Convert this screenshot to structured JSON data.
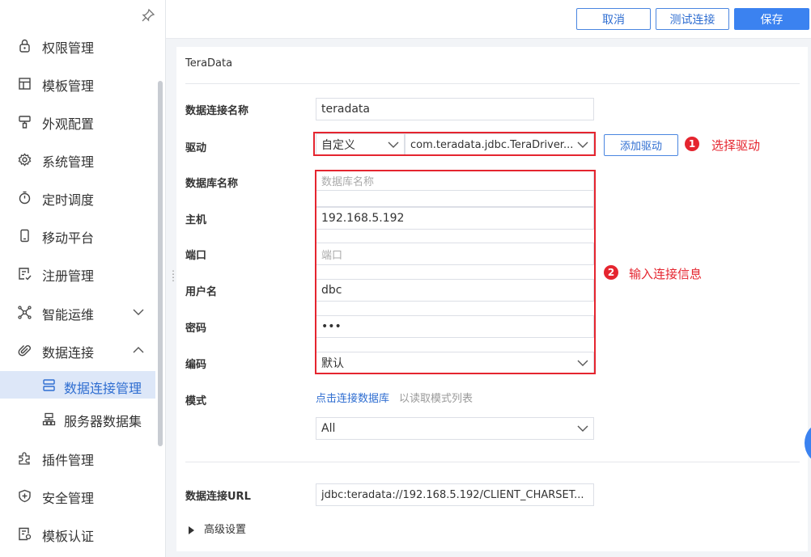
{
  "sidebar": {
    "items": [
      {
        "label": "权限管理",
        "icon": "lock-icon"
      },
      {
        "label": "模板管理",
        "icon": "template-icon"
      },
      {
        "label": "外观配置",
        "icon": "brush-icon"
      },
      {
        "label": "系统管理",
        "icon": "gear-icon"
      },
      {
        "label": "定时调度",
        "icon": "timer-icon"
      },
      {
        "label": "移动平台",
        "icon": "mobile-icon"
      },
      {
        "label": "注册管理",
        "icon": "register-icon"
      },
      {
        "label": "智能运维",
        "icon": "nodes-icon",
        "expandable": true,
        "expanded": false
      },
      {
        "label": "数据连接",
        "icon": "paperclip-icon",
        "expandable": true,
        "expanded": true
      },
      {
        "label": "插件管理",
        "icon": "puzzle-icon"
      },
      {
        "label": "安全管理",
        "icon": "shield-icon"
      },
      {
        "label": "模板认证",
        "icon": "certificate-icon"
      }
    ],
    "sub_items": [
      {
        "label": "数据连接管理",
        "icon": "db-manage-icon",
        "active": true
      },
      {
        "label": "服务器数据集",
        "icon": "server-dataset-icon",
        "active": false
      }
    ]
  },
  "toolbar": {
    "cancel_label": "取消",
    "test_label": "测试连接",
    "save_label": "保存"
  },
  "form": {
    "title": "TeraData",
    "connection_name_label": "数据连接名称",
    "connection_name_value": "teradata",
    "driver_label": "驱动",
    "driver_type": "自定义",
    "driver_class": "com.teradata.jdbc.TeraDriver...",
    "add_driver_label": "添加驱动",
    "db_name_label": "数据库名称",
    "db_name_placeholder": "数据库名称",
    "host_label": "主机",
    "host_value": "192.168.5.192",
    "port_label": "端口",
    "port_placeholder": "端口",
    "username_label": "用户名",
    "username_value": "dbc",
    "password_label": "密码",
    "password_value": "•••",
    "encoding_label": "编码",
    "encoding_value": "默认",
    "schema_label": "模式",
    "schema_link": "点击连接数据库",
    "schema_hint": "以读取模式列表",
    "schema_value": "All",
    "url_label": "数据连接URL",
    "url_value": "jdbc:teradata://192.168.5.192/CLIENT_CHARSET...",
    "advanced_label": "高级设置"
  },
  "annotations": [
    {
      "number": "1",
      "text": "选择驱动"
    },
    {
      "number": "2",
      "text": "输入连接信息"
    }
  ],
  "colors": {
    "accent": "#3b82f0",
    "annotation_red": "#e5252f",
    "active_bg": "#dde7f8"
  }
}
